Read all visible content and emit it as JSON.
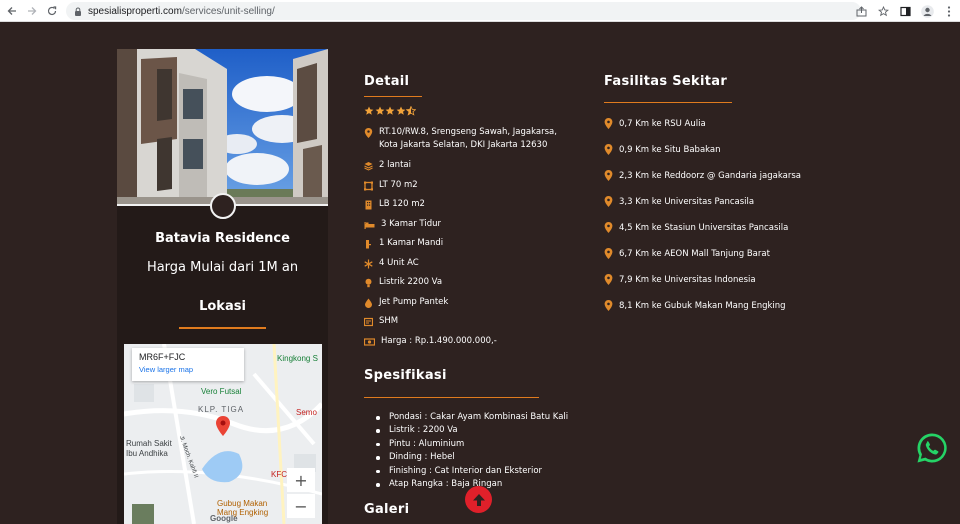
{
  "browser": {
    "url_host": "spesialisproperti.com",
    "url_path": "/services/unit-selling/"
  },
  "card": {
    "title": "Batavia Residence",
    "price": "Harga Mulai dari 1M an",
    "lokasi_title": "Lokasi",
    "map": {
      "plus_code": "MR6F+FJC",
      "larger_map_link": "View larger map",
      "labels": [
        "Kingkong S",
        "Vero Futsal",
        "KLP. TIGA",
        "Semo",
        "Rumah Sakit",
        "Ibu Andhika",
        "KFC",
        "Gubug Makan",
        "Mang Engking",
        "Jl. Moch. Kahfi II"
      ],
      "zoom_in": "+",
      "zoom_out": "−",
      "google": "Google"
    }
  },
  "detail": {
    "title": "Detail",
    "rating": 4.5,
    "address": [
      "RT.10/RW.8, Srengseng Sawah, Jagakarsa,",
      "Kota Jakarta Selatan, DKI Jakarta 12630"
    ],
    "items": [
      {
        "icon": "layers-icon",
        "text": "2 lantai"
      },
      {
        "icon": "area-icon",
        "text": "LT 70 m2"
      },
      {
        "icon": "building-icon",
        "text": "LB 120 m2"
      },
      {
        "icon": "bed-icon",
        "text": "3 Kamar Tidur"
      },
      {
        "icon": "bath-icon",
        "text": "1 Kamar Mandi"
      },
      {
        "icon": "snowflake-icon",
        "text": "4 Unit AC"
      },
      {
        "icon": "bulb-icon",
        "text": "Listrik 2200 Va"
      },
      {
        "icon": "water-drop-icon",
        "text": "Jet Pump Pantek"
      },
      {
        "icon": "certificate-icon",
        "text": "SHM"
      },
      {
        "icon": "money-icon",
        "text": "Harga : Rp.1.490.000.000,-"
      }
    ]
  },
  "spesifikasi": {
    "title": "Spesifikasi",
    "items": [
      "Pondasi : Cakar Ayam Kombinasi Batu Kali",
      "Listrik : 2200 Va",
      "Pintu : Aluminium",
      "Dinding : Hebel",
      "Finishing : Cat Interior dan Eksterior",
      "Atap Rangka : Baja Ringan"
    ]
  },
  "galeri": {
    "title": "Galeri"
  },
  "fasilitas": {
    "title": "Fasilitas Sekitar",
    "items": [
      "0,7 Km ke RSU Aulia",
      "0,9 Km ke Situ Babakan",
      "2,3 Km ke Reddoorz @ Gandaria jagakarsa",
      "3,3 Km ke Universitas Pancasila",
      "4,5 Km ke Stasiun Universitas Pancasila",
      "6,7 Km ke AEON Mall Tanjung Barat",
      "7,9 Km ke Universitas Indonesia",
      "8,1 Km ke Gubuk Makan Mang Engking"
    ]
  },
  "colors": {
    "background": "#2e2220",
    "accent": "#e07b1e",
    "star": "#f2a33a",
    "whatsapp": "#25d366",
    "scroll_top": "#e0202a"
  }
}
